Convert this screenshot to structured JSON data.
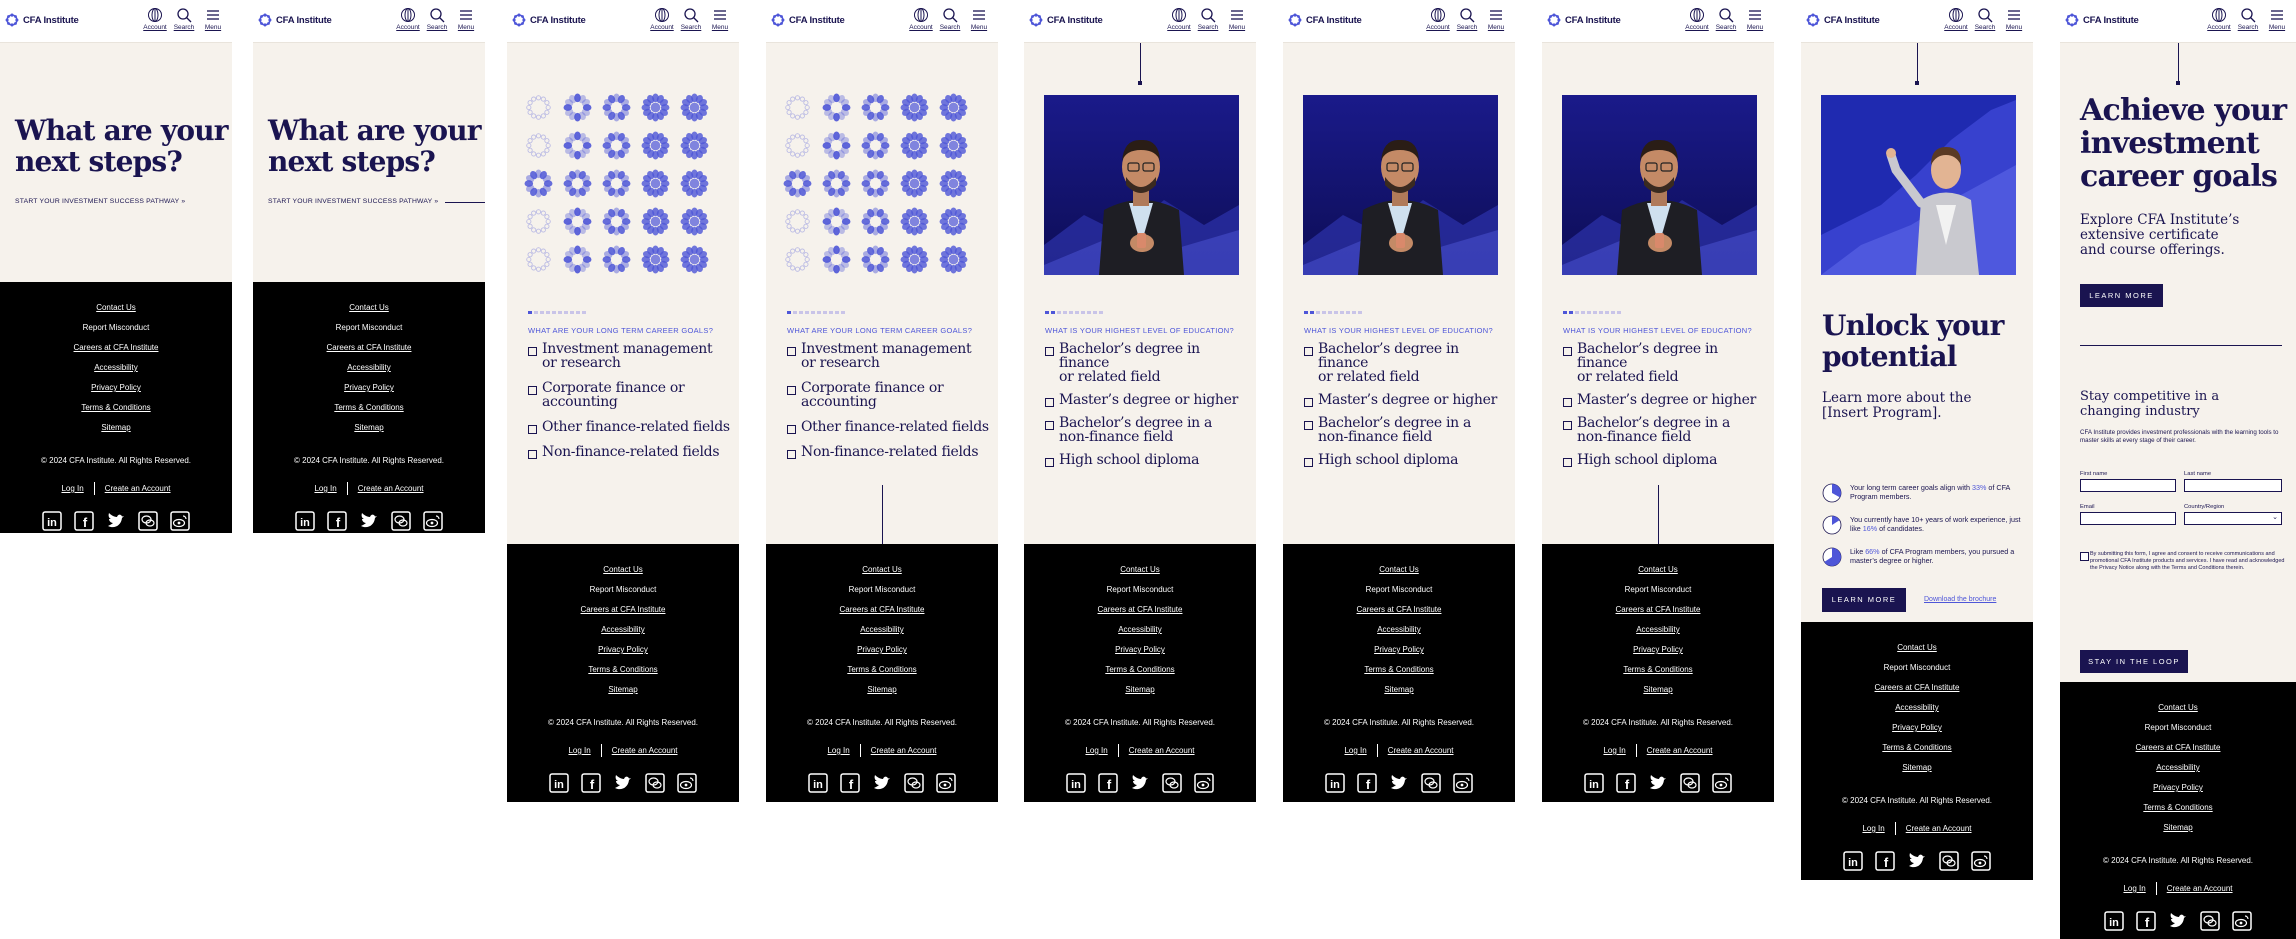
{
  "header": {
    "logo_text": "CFA Institute",
    "account_label": "Account",
    "search_label": "Search",
    "menu_label": "Menu"
  },
  "landing": {
    "title_line1": "What are your",
    "title_line2": "next steps?",
    "pathway_label": "START YOUR INVESTMENT SUCCESS PATHWAY"
  },
  "career_question": {
    "label": "WHAT ARE YOUR LONG TERM CAREER GOALS?",
    "options": [
      [
        "Investment management",
        "or research"
      ],
      [
        "Corporate finance or",
        "accounting"
      ],
      [
        "Other finance-related fields"
      ],
      [
        "Non-finance-related fields"
      ]
    ]
  },
  "education_question": {
    "label": "WHAT IS YOUR HIGHEST LEVEL OF EDUCATION?",
    "options": [
      [
        "Bachelor’s degree in finance",
        "or related field"
      ],
      [
        "Master’s degree or higher"
      ],
      [
        "Bachelor’s degree in a",
        "non-finance field"
      ],
      [
        "High school diploma"
      ]
    ]
  },
  "result": {
    "title_line1": "Unlock your",
    "title_line2": "potential",
    "sub_line1": "Learn more about the",
    "sub_line2": "[Insert Program].",
    "stats": [
      {
        "pre": "Your long term career goals align with",
        "hl": "33%",
        "post": " of CFA Program members."
      },
      {
        "pre": "You currently have 10+ years of work experience, just like",
        "hl": "16%",
        "post": " of candidates."
      },
      {
        "pre": "Like",
        "hl": "66%",
        "post": " of CFA Program members, you pursued a master’s degree or higher."
      }
    ],
    "learn_more": "LEARN MORE",
    "download": "Download the brochure"
  },
  "achieve": {
    "title_line1": "Achieve your",
    "title_line2": "investment",
    "title_line3": "career goals",
    "sub_line1": "Explore CFA Institute’s",
    "sub_line2": "extensive certificate",
    "sub_line3": "and course offerings.",
    "learn_more": "LEARN MORE",
    "stay_title_line1": "Stay competitive in a",
    "stay_title_line2": "changing industry",
    "stay_body": "CFA Institute provides investment professionals with the learning tools to master skills at every stage of their career.",
    "first_name": "First name",
    "last_name": "Last name",
    "email": "Email",
    "country": "Country/Region",
    "consent": "By submitting this form, I agree and consent to receive communications and promotional CFA Institute products and services. I have read and acknowledged the Privacy Notice along with the Terms and Conditions therein.",
    "stay_button": "STAY IN THE LOOP"
  },
  "footer": {
    "links": [
      "Contact Us",
      "Report Misconduct",
      "Careers at CFA Institute",
      "Accessibility",
      "Privacy Policy",
      "Terms & Conditions",
      "Sitemap"
    ],
    "copyright": "© 2024 CFA Institute. All Rights Reserved.",
    "login": "Log In",
    "create_account": "Create an Account",
    "socials": [
      "linkedin-icon",
      "facebook-icon",
      "twitter-icon",
      "wechat-icon",
      "weibo-icon"
    ]
  },
  "colors": {
    "navy": "#1a1450",
    "accent": "#4e56d8",
    "cream": "#f6f2ec",
    "footer": "#000000"
  }
}
